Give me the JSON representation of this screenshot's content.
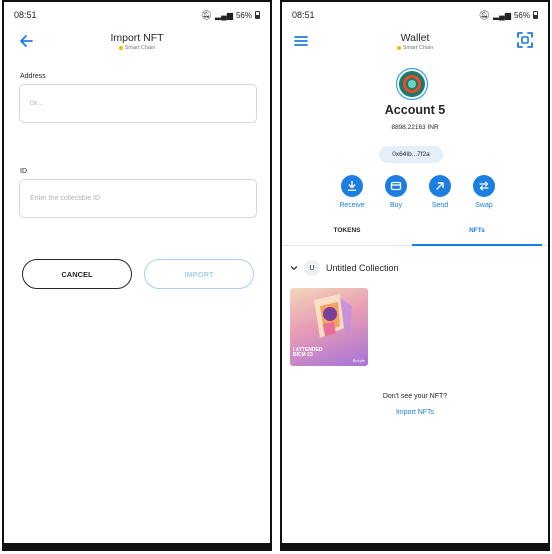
{
  "import_screen": {
    "status": {
      "time": "08:51",
      "battery": "56%"
    },
    "header": {
      "title": "Import NFT",
      "subtitle": "Smart Chain"
    },
    "address": {
      "label": "Address",
      "placeholder": "0x..."
    },
    "id": {
      "label": "ID",
      "placeholder": "Enter the collectible ID"
    },
    "buttons": {
      "cancel": "CANCEL",
      "import": "IMPORT"
    }
  },
  "wallet_screen": {
    "status": {
      "time": "08:51",
      "battery": "56%"
    },
    "header": {
      "title": "Wallet",
      "subtitle": "Smart Chain"
    },
    "account": {
      "name": "Account 5",
      "balance": "8898.22163 INR",
      "address": "0x64Ib...7f2a"
    },
    "actions": [
      {
        "label": "Receive",
        "icon": "download-icon"
      },
      {
        "label": "Buy",
        "icon": "card-icon"
      },
      {
        "label": "Send",
        "icon": "arrow-up-right-icon"
      },
      {
        "label": "Swap",
        "icon": "swap-icon"
      }
    ],
    "tabs": [
      "TOKENS",
      "NFTs"
    ],
    "active_tab": "NFTs",
    "collection": {
      "badge": "U",
      "name": "Untitled Collection",
      "nft": {
        "caption_line1": "I ATTENDED",
        "caption_line2": "BICM 23",
        "tag": "BeLyfe"
      }
    },
    "empty_prompt": "Don't see your NFT?",
    "import_link": "Import NFTs"
  },
  "colors": {
    "accent": "#1c7ee0",
    "accent_disabled": "#a9cdf3",
    "network_dot": "#f0b90b"
  }
}
